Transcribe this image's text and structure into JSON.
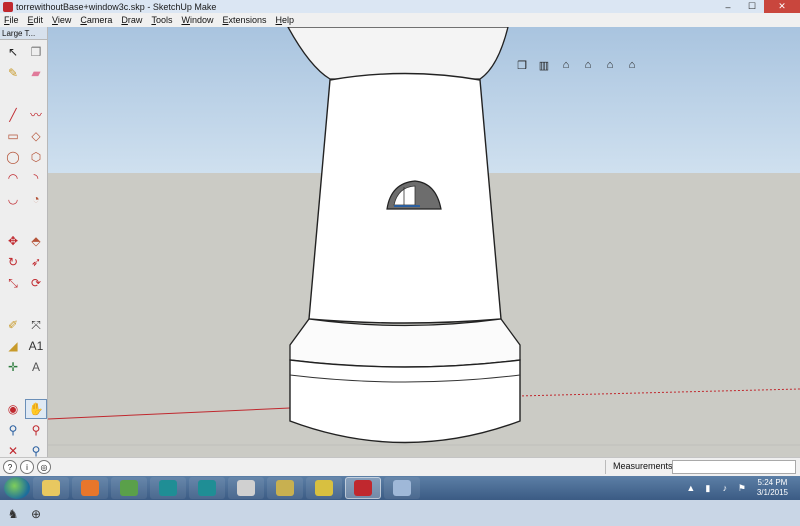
{
  "window": {
    "title": "torrewithoutBase+window3c.skp - SketchUp Make",
    "controls": {
      "minimize": "‒",
      "maximize": "☐",
      "close": "✕"
    }
  },
  "menu": [
    "File",
    "Edit",
    "View",
    "Camera",
    "Draw",
    "Tools",
    "Window",
    "Extensions",
    "Help"
  ],
  "tool_panel": {
    "title": "Large T...",
    "tools": [
      {
        "name": "select-tool",
        "glyph": "↖",
        "color": "#222222"
      },
      {
        "name": "make-component-tool",
        "glyph": "❒",
        "color": "#777777"
      },
      {
        "name": "paint-bucket-tool",
        "glyph": "✎",
        "color": "#c89a2a"
      },
      {
        "name": "eraser-tool",
        "glyph": "▰",
        "color": "#e07a9a"
      },
      {
        "name": "line-tool",
        "glyph": "╱",
        "color": "#c0282e"
      },
      {
        "name": "freehand-tool",
        "glyph": "〰",
        "color": "#c0282e"
      },
      {
        "name": "rectangle-tool",
        "glyph": "▭",
        "color": "#b5553a"
      },
      {
        "name": "rotated-rectangle-tool",
        "glyph": "◇",
        "color": "#b5553a"
      },
      {
        "name": "circle-tool",
        "glyph": "◯",
        "color": "#b5553a"
      },
      {
        "name": "polygon-tool",
        "glyph": "⬡",
        "color": "#b5553a"
      },
      {
        "name": "arc-tool",
        "glyph": "◠",
        "color": "#c0282e"
      },
      {
        "name": "two-point-arc-tool",
        "glyph": "◝",
        "color": "#c0282e"
      },
      {
        "name": "three-point-arc-tool",
        "glyph": "◡",
        "color": "#c0282e"
      },
      {
        "name": "pie-tool",
        "glyph": "◔",
        "color": "#b5553a"
      },
      {
        "name": "move-tool",
        "glyph": "✥",
        "color": "#c0282e"
      },
      {
        "name": "push-pull-tool",
        "glyph": "⬘",
        "color": "#b5553a"
      },
      {
        "name": "rotate-tool",
        "glyph": "↻",
        "color": "#c0282e"
      },
      {
        "name": "follow-me-tool",
        "glyph": "➶",
        "color": "#c0282e"
      },
      {
        "name": "scale-tool",
        "glyph": "⤡",
        "color": "#c0282e"
      },
      {
        "name": "offset-tool",
        "glyph": "⟳",
        "color": "#c0282e"
      },
      {
        "name": "tape-measure-tool",
        "glyph": "✐",
        "color": "#c89a2a"
      },
      {
        "name": "dimension-tool",
        "glyph": "⤧",
        "color": "#333333"
      },
      {
        "name": "protractor-tool",
        "glyph": "◢",
        "color": "#c89a2a"
      },
      {
        "name": "text-tool",
        "glyph": "A1",
        "color": "#333333"
      },
      {
        "name": "axes-tool",
        "glyph": "✛",
        "color": "#2a7a3a"
      },
      {
        "name": "3d-text-tool",
        "glyph": "A",
        "color": "#555555"
      },
      {
        "name": "orbit-tool",
        "glyph": "◉",
        "color": "#c0282e"
      },
      {
        "name": "pan-tool",
        "glyph": "✋",
        "color": "#555555"
      },
      {
        "name": "zoom-tool",
        "glyph": "⚲",
        "color": "#2a5fa0"
      },
      {
        "name": "zoom-window-tool",
        "glyph": "⚲",
        "color": "#c0282e"
      },
      {
        "name": "zoom-extents-tool",
        "glyph": "✕",
        "color": "#c0282e"
      },
      {
        "name": "previous-view-tool",
        "glyph": "⚲",
        "color": "#2a5fa0"
      },
      {
        "name": "position-camera-tool",
        "glyph": "♜",
        "color": "#333333"
      },
      {
        "name": "look-around-tool",
        "glyph": "◉",
        "color": "#333333"
      },
      {
        "name": "walk-tool",
        "glyph": "♞",
        "color": "#333333"
      },
      {
        "name": "section-plane-tool",
        "glyph": "⊕",
        "color": "#333333"
      }
    ],
    "selected_tool": "pan-tool"
  },
  "views_toolbar": [
    {
      "name": "iso-view-button",
      "glyph": "❒"
    },
    {
      "name": "top-view-button",
      "glyph": "▥"
    },
    {
      "name": "front-view-button",
      "glyph": "⌂"
    },
    {
      "name": "right-view-button",
      "glyph": "⌂"
    },
    {
      "name": "back-view-button",
      "glyph": "⌂"
    },
    {
      "name": "left-view-button",
      "glyph": "⌂"
    }
  ],
  "status_bar": {
    "icons": [
      "?",
      "i",
      "◎"
    ],
    "measurements_label": "Measurements",
    "measurements_value": ""
  },
  "taskbar": {
    "apps": [
      {
        "name": "explorer-app",
        "color": "#e8c860"
      },
      {
        "name": "firefox-app",
        "color": "#e8762b"
      },
      {
        "name": "solitaire-app",
        "color": "#5aa04a"
      },
      {
        "name": "arduino-app",
        "color": "#1f8e95"
      },
      {
        "name": "arduino-app-2",
        "color": "#1f8e95"
      },
      {
        "name": "pdf-app",
        "color": "#d0d0d0"
      },
      {
        "name": "photo-app",
        "color": "#c8b050"
      },
      {
        "name": "game-app",
        "color": "#d8c040"
      },
      {
        "name": "sketchup-app",
        "color": "#c0282e",
        "active": true
      },
      {
        "name": "paint-app",
        "color": "#9fb8d8"
      }
    ],
    "clock": {
      "time": "5:24 PM",
      "date": "3/1/2015"
    }
  }
}
